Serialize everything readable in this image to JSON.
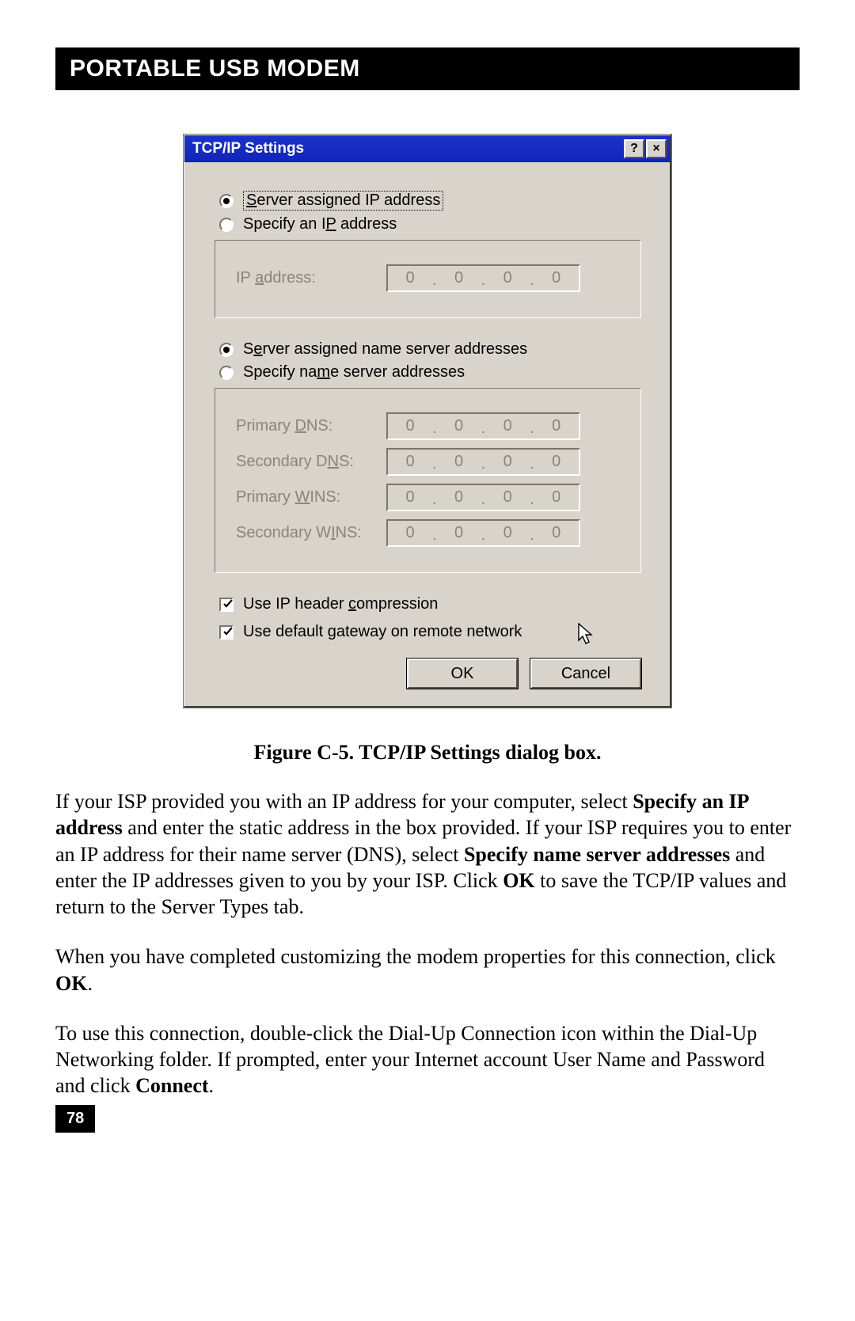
{
  "header": "PORTABLE USB MODEM",
  "dialog": {
    "title": "TCP/IP Settings",
    "help_btn": "?",
    "close_btn": "×",
    "radio1a": "Server assigned IP address",
    "radio1b": "Specify an IP address",
    "ip_label": "IP address:",
    "radio2a": "Server assigned name server addresses",
    "radio2b": "Specify name server addresses",
    "primary_dns": "Primary DNS:",
    "secondary_dns": "Secondary DNS:",
    "primary_wins": "Primary WINS:",
    "secondary_wins": "Secondary WINS:",
    "oct": "0",
    "dot": ".",
    "check1": "Use IP header compression",
    "check2": "Use default gateway on remote network",
    "ok": "OK",
    "cancel": "Cancel"
  },
  "caption": "Figure C-5. TCP/IP Settings dialog box.",
  "para1_a": "If your ISP provided you with an IP address for your computer, select ",
  "para1_b": "Specify an IP address",
  "para1_c": " and enter the static address in the box provided.  If your ISP requires you to enter an IP address for their name server (DNS), select ",
  "para1_d": "Specify name server addresses",
  "para1_e": " and enter the IP addresses given to you by your ISP. Click ",
  "para1_f": "OK",
  "para1_g": " to save the TCP/IP values and return to the Server Types tab.",
  "para2_a": "When you have completed customizing the modem properties for this connection, click ",
  "para2_b": "OK",
  "para2_c": ".",
  "para3_a": "To use this connection, double-click the Dial-Up Connection icon within the Dial-Up Networking folder. If prompted, enter your Internet account User Name and Password and click ",
  "para3_b": "Connect",
  "para3_c": ".",
  "page_num": "78"
}
